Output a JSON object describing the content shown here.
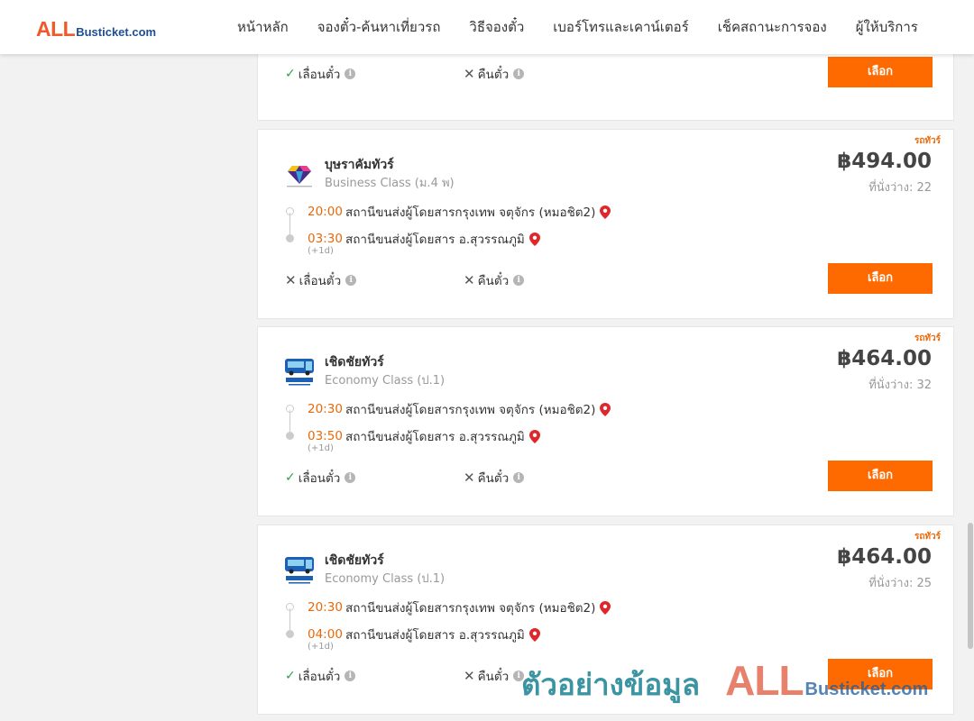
{
  "header": {
    "logo_all": "ALL",
    "logo_rest": "Busticket.com",
    "nav": [
      "หน้าหลัก",
      "จองตั๋ว-ค้นหาเที่ยวรถ",
      "วิธีจองตั๋ว",
      "เบอร์โทรและเคาน์เตอร์",
      "เช็คสถานะการจอง",
      "ผู้ให้บริการ"
    ]
  },
  "common": {
    "select_label": "เลือก",
    "change_label": "เลื่อนตั๋ว",
    "refund_label": "คืนตั๋ว",
    "plus_day": "(+1d)",
    "seats_prefix": "ที่นั่งว่าง: ",
    "currency": "฿"
  },
  "cards": [
    {
      "type_tag": "",
      "operator": "",
      "class": "",
      "dep_time": "",
      "dep_station": "",
      "arr_time": "",
      "arr_station": "",
      "price": "",
      "seats": "",
      "change_allowed": true,
      "refund_allowed": false,
      "partial": true
    },
    {
      "type_tag": "รถทัวร์",
      "operator": "บุษราคัมทัวร์",
      "class": "Business Class (ม.4 พ)",
      "logo_icon": "diamond-icon",
      "dep_time": "20:00",
      "dep_station": "สถานีขนส่งผู้โดยสารกรุงเทพ จตุจักร (หมอชิต2)",
      "arr_time": "03:30",
      "arr_station": "สถานีขนส่งผู้โดยสาร อ.สุวรรณภูมิ",
      "price": "฿494.00",
      "seats": "ที่นั่งว่าง: 22",
      "change_allowed": false,
      "refund_allowed": false
    },
    {
      "type_tag": "รถทัวร์",
      "operator": "เชิดชัยทัวร์",
      "class": "Economy Class (ป.1)",
      "logo_icon": "bus-icon",
      "dep_time": "20:30",
      "dep_station": "สถานีขนส่งผู้โดยสารกรุงเทพ จตุจักร (หมอชิต2)",
      "arr_time": "03:50",
      "arr_station": "สถานีขนส่งผู้โดยสาร อ.สุวรรณภูมิ",
      "price": "฿464.00",
      "seats": "ที่นั่งว่าง: 32",
      "change_allowed": true,
      "refund_allowed": false
    },
    {
      "type_tag": "รถทัวร์",
      "operator": "เชิดชัยทัวร์",
      "class": "Economy Class (ป.1)",
      "logo_icon": "bus-icon",
      "dep_time": "20:30",
      "dep_station": "สถานีขนส่งผู้โดยสารกรุงเทพ จตุจักร (หมอชิต2)",
      "arr_time": "04:00",
      "arr_station": "สถานีขนส่งผู้โดยสาร อ.สุวรรณภูมิ",
      "price": "฿464.00",
      "seats": "ที่นั่งว่าง: 25",
      "change_allowed": true,
      "refund_allowed": false
    }
  ],
  "watermark": {
    "text": "ตัวอย่างข้อมูล",
    "all": "ALL",
    "rest": "Busticket.com"
  },
  "colors": {
    "accent": "#ff6a00",
    "time": "#e8690a",
    "brand_red": "#ef5a28",
    "brand_blue": "#1d4f91",
    "ok_green": "#2aa44f"
  }
}
